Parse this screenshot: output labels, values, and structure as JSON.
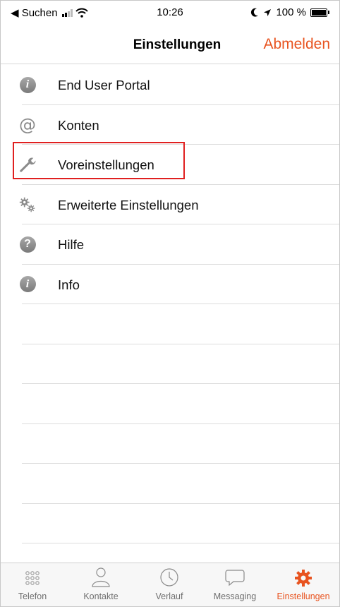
{
  "status_bar": {
    "back_app": "◀ Suchen",
    "time": "10:26",
    "battery_label": "100 %"
  },
  "header": {
    "title": "Einstellungen",
    "logout_label": "Abmelden"
  },
  "settings_items": [
    {
      "label": "End User Portal",
      "icon": "info-icon"
    },
    {
      "label": "Konten",
      "icon": "at-icon"
    },
    {
      "label": "Voreinstellungen",
      "icon": "wrench-icon",
      "highlighted": true
    },
    {
      "label": "Erweiterte Einstellungen",
      "icon": "gears-icon"
    },
    {
      "label": "Hilfe",
      "icon": "help-icon"
    },
    {
      "label": "Info",
      "icon": "info-icon"
    }
  ],
  "tab_bar": {
    "tabs": [
      {
        "label": "Telefon",
        "icon": "keypad-icon",
        "active": false
      },
      {
        "label": "Kontakte",
        "icon": "contact-icon",
        "active": false
      },
      {
        "label": "Verlauf",
        "icon": "clock-icon",
        "active": false
      },
      {
        "label": "Messaging",
        "icon": "chat-icon",
        "active": false
      },
      {
        "label": "Einstellungen",
        "icon": "gear-icon",
        "active": true
      }
    ]
  },
  "colors": {
    "accent": "#e8531f",
    "highlight_border": "#e02020",
    "separator": "#dcdcdc"
  }
}
